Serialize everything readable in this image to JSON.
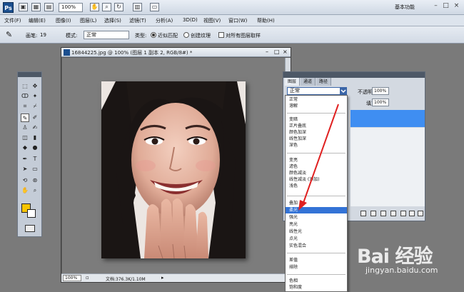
{
  "app": {
    "logo": "Ps",
    "zoom": "100%",
    "workspace": "基本功能",
    "window_buttons": [
      "–",
      "□",
      "×"
    ]
  },
  "menu": [
    "文件(F)",
    "编辑(E)",
    "图像(I)",
    "图层(L)",
    "选择(S)",
    "滤镜(T)",
    "分析(A)",
    "3D(D)",
    "视图(V)",
    "窗口(W)",
    "帮助(H)"
  ],
  "options": {
    "brush_label": "画笔:",
    "brush_size": "19",
    "mode_label": "模式:",
    "mode_value": "正常",
    "type_label": "类型:",
    "radio1": "近似匹配",
    "radio2": "创建纹理",
    "checkbox": "对所有图层取样"
  },
  "document": {
    "title": "16844225.jpg @ 100% (图层 1 副本 2, RGB/8#) *",
    "zoom": "100%",
    "info": "文档:376.3K/1.10M"
  },
  "panel": {
    "tabs": [
      "图层",
      "通道",
      "路径"
    ],
    "blend_value": "正常",
    "opacity_label": "不透明度:",
    "opacity_value": "100%",
    "fill_label": "填充:",
    "fill_value": "100%"
  },
  "blend_modes": [
    [
      "正常",
      "溶解"
    ],
    [
      "变暗",
      "正片叠底",
      "颜色加深",
      "线性加深",
      "深色"
    ],
    [
      "变亮",
      "滤色",
      "颜色减淡",
      "线性减淡 (添加)",
      "浅色"
    ],
    [
      "叠加",
      "柔光",
      "强光",
      "亮光",
      "线性光",
      "点光",
      "实色混合"
    ],
    [
      "差值",
      "排除"
    ],
    [
      "色相",
      "饱和度"
    ]
  ],
  "highlighted_mode": "柔光",
  "colors": {
    "foreground": "#f6c400",
    "background": "#ffffff",
    "highlight": "#3373d6",
    "arrow": "#e02020"
  },
  "watermark": {
    "logo": "Bai 经验",
    "url": "jingyan.baidu.com"
  }
}
